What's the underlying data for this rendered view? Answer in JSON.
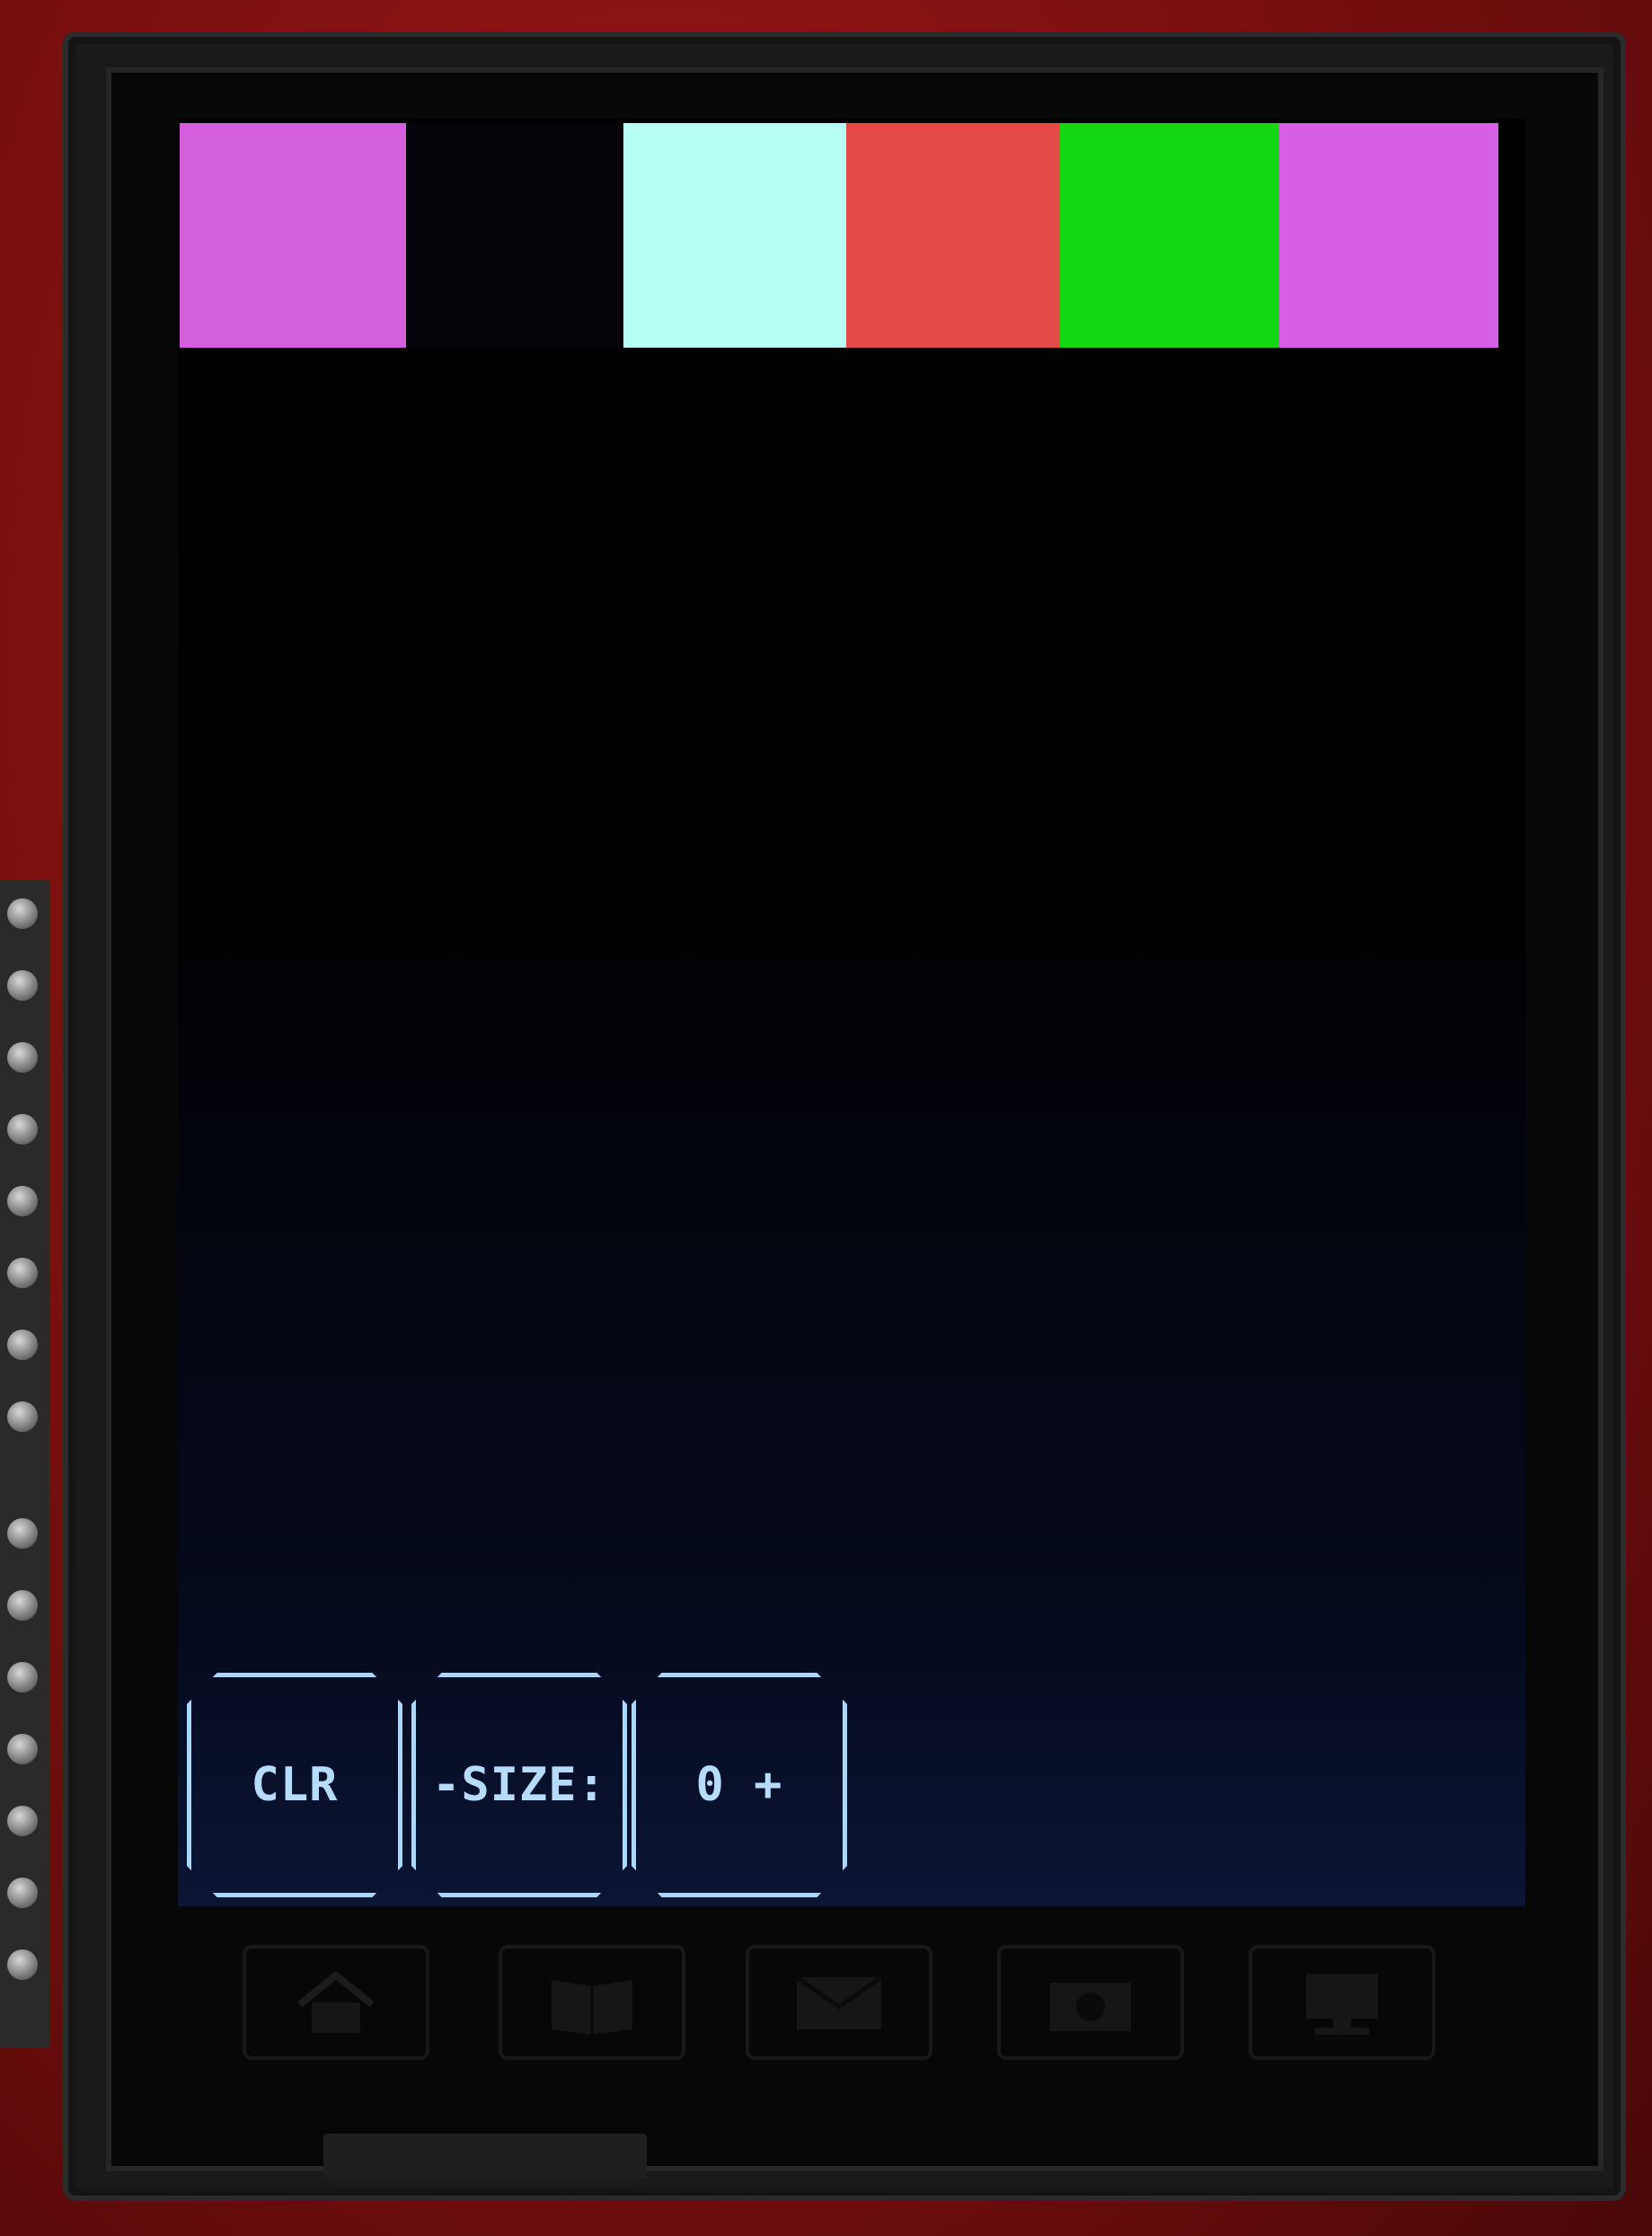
{
  "palette": {
    "swatches": [
      {
        "name": "magenta",
        "color": "#d35fdc"
      },
      {
        "name": "black",
        "color": "#03030a"
      },
      {
        "name": "cyan",
        "color": "#b8fff4"
      },
      {
        "name": "red",
        "color": "#e44a47"
      },
      {
        "name": "green",
        "color": "#14d713"
      },
      {
        "name": "magenta-2",
        "color": "#d65fe6"
      }
    ]
  },
  "buttons": {
    "clear_label": "CLR",
    "size_minus_label": "-SIZE:",
    "size_value_label": "0 +"
  },
  "colors": {
    "button_outline": "#a9d8ff",
    "screen_bg": "#000000"
  },
  "touch_icons": [
    "home-icon",
    "book-icon",
    "mail-icon",
    "camera-icon",
    "computer-icon"
  ]
}
